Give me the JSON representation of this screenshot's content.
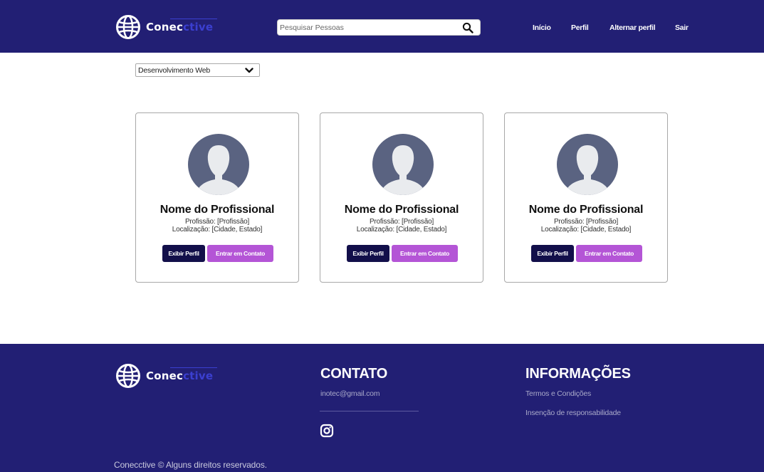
{
  "brand": {
    "name_part1": "Conec",
    "name_part2": "ctive"
  },
  "search": {
    "placeholder": "Pesquisar Pessoas",
    "icon": "search-icon"
  },
  "nav": {
    "items": [
      "Início",
      "Perfil",
      "Alternar perfil",
      "Sair"
    ]
  },
  "filter": {
    "selected": "Desenvolvimento Web",
    "icon": "chevron-down-icon"
  },
  "cards": [
    {
      "name": "Nome do Profissional",
      "profession": "Profissão: [Profissão]",
      "location": "Localização: [Cidade, Estado]",
      "view_label": "Exibir Perfil",
      "contact_label": "Entrar em Contato"
    },
    {
      "name": "Nome do Profissional",
      "profession": "Profissão: [Profissão]",
      "location": "Localização: [Cidade, Estado]",
      "view_label": "Exibir Perfil",
      "contact_label": "Entrar em Contato"
    },
    {
      "name": "Nome do Profissional",
      "profession": "Profissão: [Profissão]",
      "location": "Localização: [Cidade, Estado]",
      "view_label": "Exibir Perfil",
      "contact_label": "Entrar em Contato"
    }
  ],
  "footer": {
    "contact_title": "CONTATO",
    "email": "inotec@gmail.com",
    "social_icon": "instagram-icon",
    "info_title": "INFORMAÇÕES",
    "info_links": [
      "Termos e Condições",
      "Insenção de responsabilidade"
    ],
    "copyright": "Conecctive © Alguns direitos reservados."
  },
  "colors": {
    "primary": "#221f74",
    "button_dark": "#120f4a",
    "button_accent": "#b455d6",
    "logo_accent": "#3b3fd0",
    "avatar": "#5a6381",
    "avatar_bg": "#e9ebee"
  }
}
